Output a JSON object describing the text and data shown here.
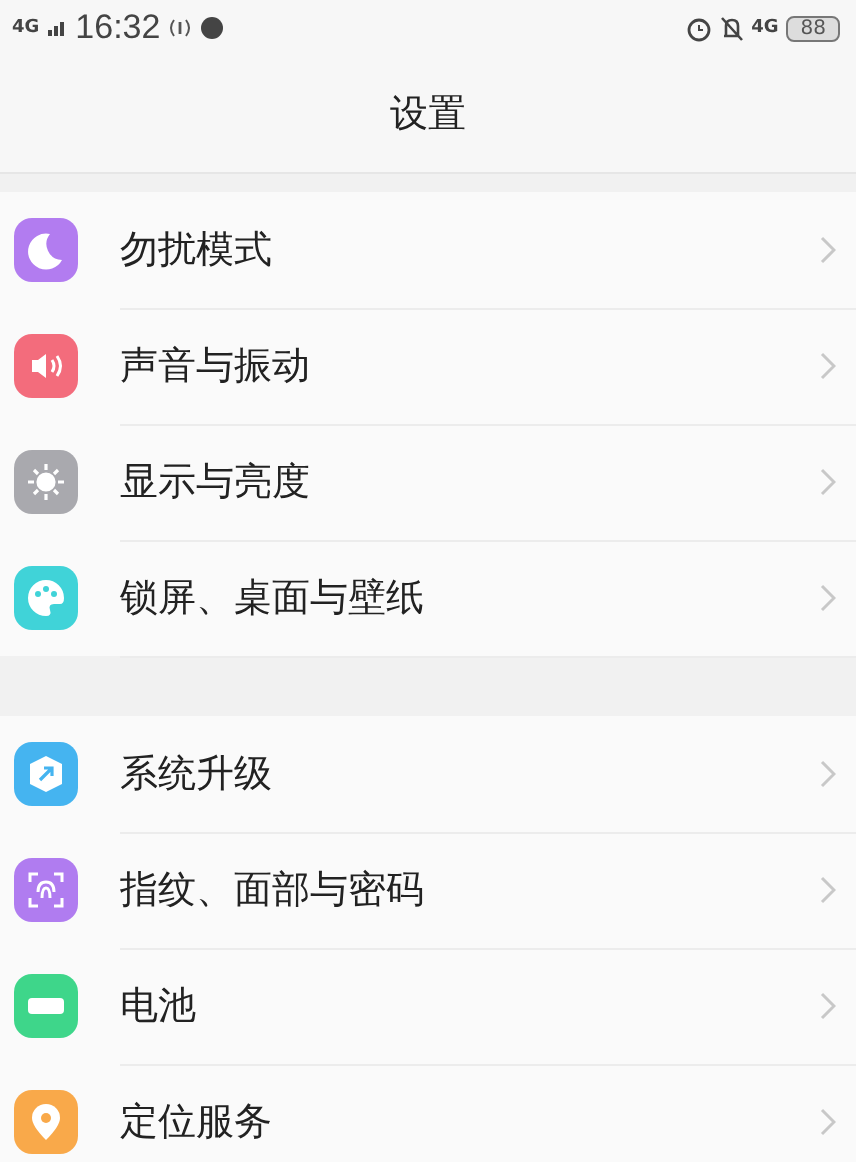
{
  "status_bar": {
    "network_left": "4G",
    "time": "16:32",
    "network_right": "4G",
    "battery": "88"
  },
  "title": "设置",
  "groups": [
    {
      "items": [
        {
          "label": "勿扰模式",
          "kind": "moon",
          "color": "#b27cf0"
        },
        {
          "label": "声音与振动",
          "kind": "speaker",
          "color": "#f36c7c"
        },
        {
          "label": "显示与亮度",
          "kind": "sun",
          "color": "#a9a9ae"
        },
        {
          "label": "锁屏、桌面与壁纸",
          "kind": "palette",
          "color": "#40d3d8"
        }
      ]
    },
    {
      "items": [
        {
          "label": "系统升级",
          "kind": "update",
          "color": "#45b4f0"
        },
        {
          "label": "指纹、面部与密码",
          "kind": "fingerprint",
          "color": "#b07cf0"
        },
        {
          "label": "电池",
          "kind": "battery",
          "color": "#3ed68a"
        },
        {
          "label": "定位服务",
          "kind": "pin",
          "color": "#f9a94a"
        }
      ]
    }
  ]
}
